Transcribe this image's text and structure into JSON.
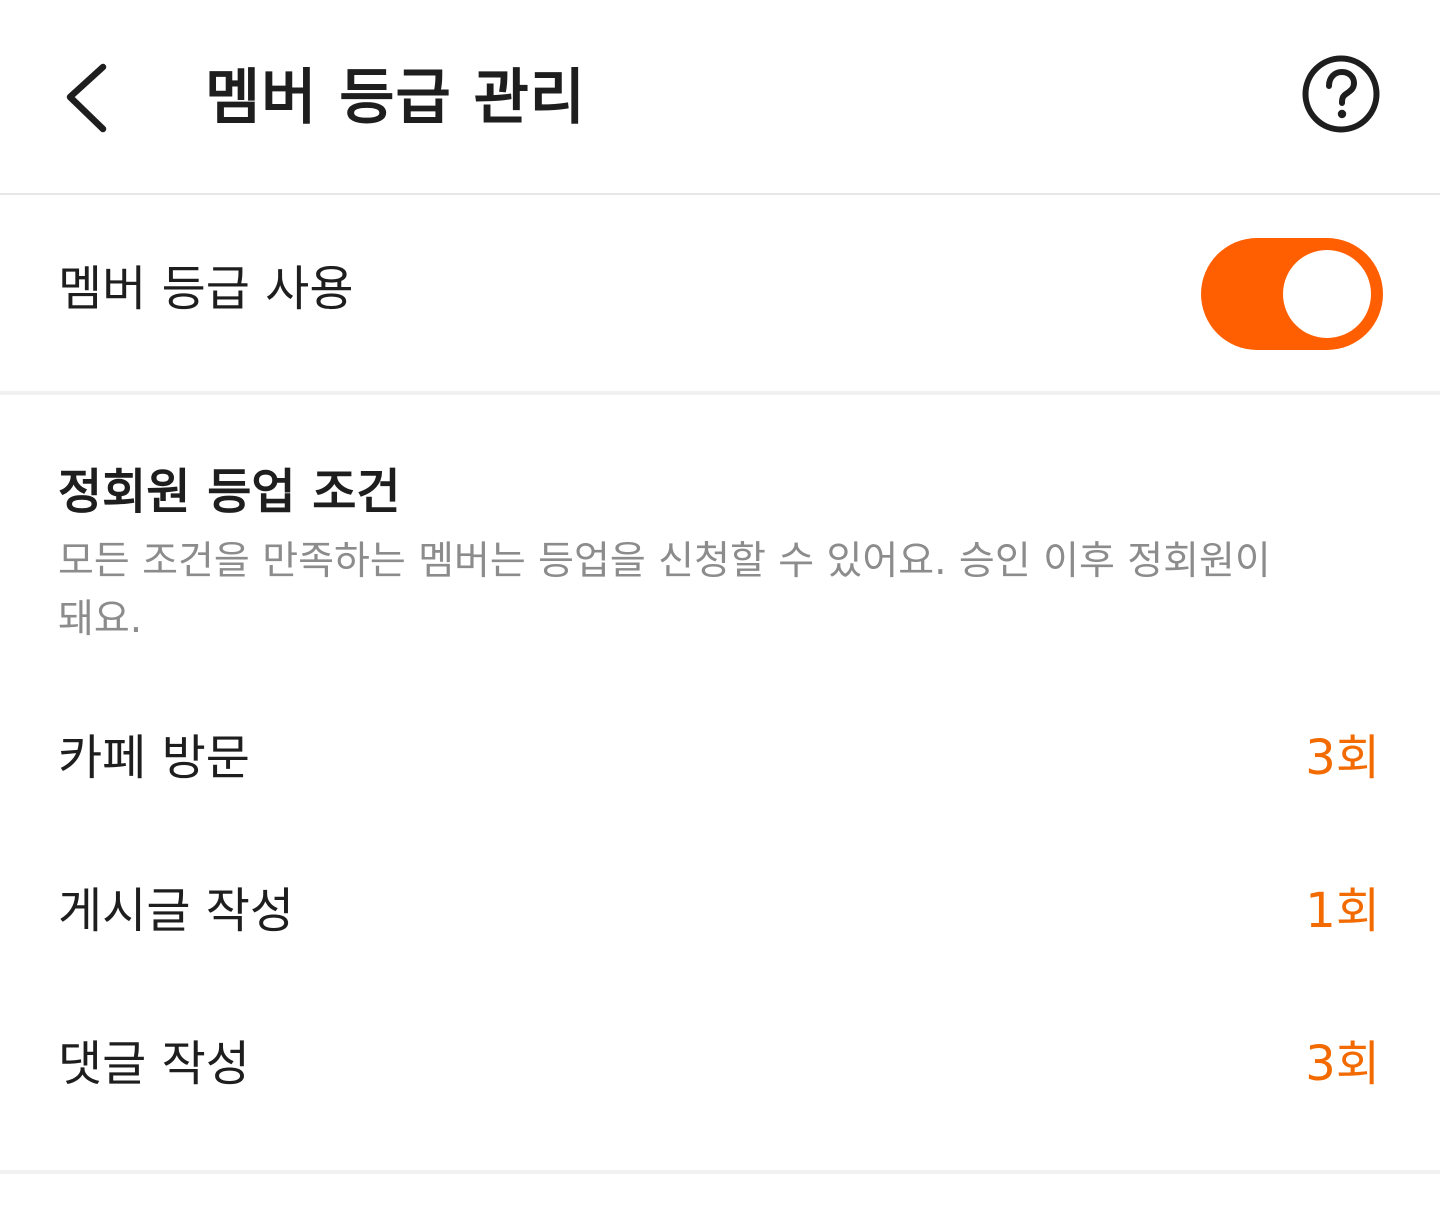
{
  "header": {
    "back_icon": "chevron-left-icon",
    "title": "멤버 등급 관리",
    "help_icon": "question-circle-icon"
  },
  "toggle_row": {
    "label": "멤버 등급 사용",
    "enabled": true,
    "accent_color": "#ff5f00"
  },
  "conditions": {
    "title": "정회원 등업 조건",
    "description": "모든 조건을 만족하는 멤버는 등업을 신청할 수 있어요. 승인 이후 정회원이 돼요.",
    "value_color": "#f26a00",
    "items": [
      {
        "label": "카페 방문",
        "value": "3회"
      },
      {
        "label": "게시글 작성",
        "value": "1회"
      },
      {
        "label": "댓글 작성",
        "value": "3회"
      }
    ]
  }
}
